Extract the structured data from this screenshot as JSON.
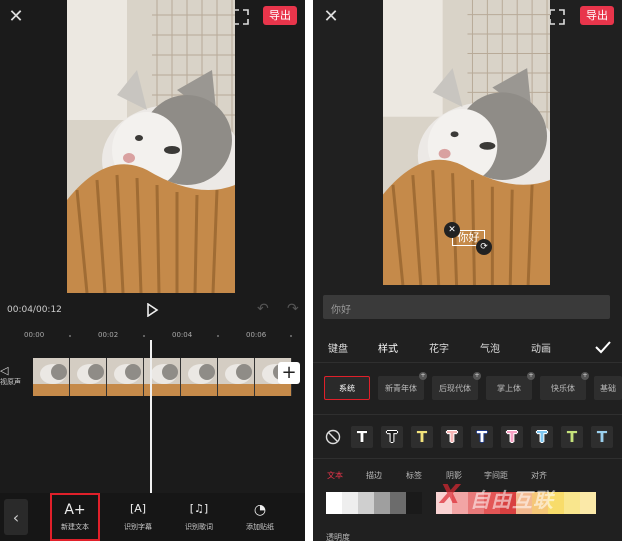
{
  "left_screen": {
    "export_label": "导出",
    "time_display": "00:04/00:12",
    "ruler_ticks": [
      "00:00",
      "00:02",
      "00:04",
      "00:06"
    ],
    "side_label": "视原声",
    "add_clip": "+",
    "toolbar": {
      "back": "‹",
      "tools": [
        {
          "icon": "A+",
          "label": "新建文本",
          "active": true
        },
        {
          "icon": "[A]",
          "label": "识别字幕",
          "active": false
        },
        {
          "icon": "[♫]",
          "label": "识别歌词",
          "active": false
        },
        {
          "icon": "◔",
          "label": "添加贴纸",
          "active": false
        }
      ]
    }
  },
  "right_screen": {
    "export_label": "导出",
    "overlay_text": "你好",
    "text_input": "你好",
    "tabs": [
      "键盘",
      "样式",
      "花字",
      "气泡",
      "动画"
    ],
    "selected_tab": "样式",
    "fonts": [
      "系统",
      "新青年体",
      "后现代体",
      "掌上体",
      "快乐体",
      "基础"
    ],
    "selected_font": "系统",
    "presets": [
      {
        "fill": "#ffffff",
        "stroke": "#222222"
      },
      {
        "fill": "#1b1b1b",
        "stroke": "#ffffff"
      },
      {
        "fill": "#f2e27a",
        "stroke": "#333333"
      },
      {
        "fill": "#f6b5b5",
        "stroke": "#ffffff"
      },
      {
        "fill": "#ffffff",
        "stroke": "#1e3a8a"
      },
      {
        "fill": "#f7a1c4",
        "stroke": "#ffffff"
      },
      {
        "fill": "#7ec6f0",
        "stroke": "#ffffff"
      },
      {
        "fill": "#c5e27a",
        "stroke": "#333333"
      },
      {
        "fill": "#9bd0ee",
        "stroke": "#333333"
      }
    ],
    "subtabs": [
      "文本",
      "描边",
      "标签",
      "阴影",
      "字间距",
      "对齐"
    ],
    "selected_subtab": "文本",
    "opacity_label": "透明度",
    "swatch_colors": [
      "#ffffff",
      "#eeeeee",
      "#cfcfcf",
      "#9f9f9f",
      "#6c6c6c",
      "#1a1a1a",
      "#f9d3d3",
      "#f2a5a5",
      "#e87a7a",
      "#e35656",
      "#d84040",
      "#f3b98f",
      "#f5c778",
      "#f8dc6a",
      "#f9e68d",
      "#fbe9a8"
    ],
    "watermark": "自由互联"
  },
  "accent_color": "#e8354b"
}
